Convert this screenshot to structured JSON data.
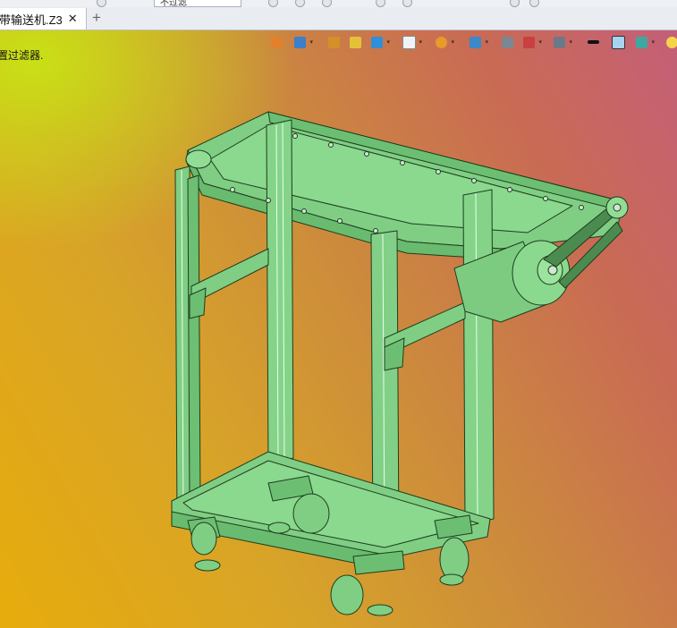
{
  "window": {
    "combo_text": "不过滤"
  },
  "tabs": [
    {
      "label": "带输送机.Z3",
      "close": "✕"
    }
  ],
  "new_tab_label": "+",
  "viewport": {
    "filter_hint": "置过滤器.",
    "bg_colors": {
      "top_left": "#c8e414",
      "center": "#d8a428",
      "right": "#c45f78",
      "bottom": "#e7ac0c"
    },
    "model_color": "#7fce84",
    "model_edge_color": "#1f3d1f"
  },
  "view_toolbar": [
    {
      "name": "exit-sketch-icon",
      "color": "#e2812c"
    },
    {
      "name": "view-cube-icon",
      "color": "#3d7fc8",
      "dropdown": true
    },
    {
      "name": "pen-tool-icon",
      "color": "#d4902a"
    },
    {
      "name": "solid-shade-icon",
      "color": "#e3c23a"
    },
    {
      "name": "blue-cube-icon",
      "color": "#2f8fd8",
      "dropdown": true
    },
    {
      "name": "white-cube-icon",
      "color": "#f0f2f4",
      "dropdown": true
    },
    {
      "name": "render-ball-icon",
      "color": "#e89a2a",
      "dropdown": true
    },
    {
      "name": "zoom-fit-icon",
      "color": "#3b89c9",
      "dropdown": true
    },
    {
      "name": "section-view-icon",
      "color": "#7b8792"
    },
    {
      "name": "clip-plane-icon",
      "color": "#c84040",
      "dropdown": true
    },
    {
      "name": "display-mode-icon",
      "color": "#6c7a88",
      "dropdown": true
    },
    {
      "name": "line-weight-icon",
      "color": "#111111"
    },
    {
      "name": "color-swatch-icon",
      "color": "#a6d3ee"
    },
    {
      "name": "layer-icon",
      "color": "#3ea8a0",
      "dropdown": true
    },
    {
      "name": "light-bulb-icon",
      "color": "#f3d54a"
    }
  ]
}
